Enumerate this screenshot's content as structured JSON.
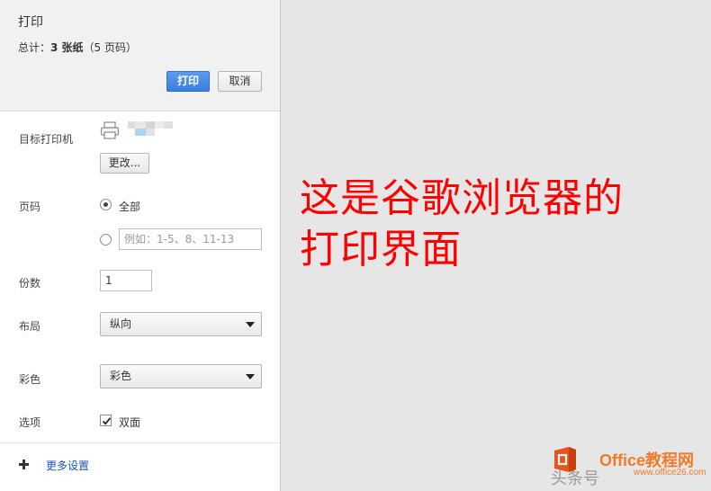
{
  "header": {
    "title": "打印",
    "summary_prefix": "总计：",
    "summary_count": "3 张纸",
    "summary_suffix": "（5 页码）",
    "print_label": "打印",
    "cancel_label": "取消"
  },
  "destination": {
    "label": "目标打印机",
    "change_label": "更改..."
  },
  "pages": {
    "label": "页码",
    "all_label": "全部",
    "all_selected": true,
    "custom_placeholder": "例如：1-5、8、11-13"
  },
  "copies": {
    "label": "份数",
    "value": "1"
  },
  "layout": {
    "label": "布局",
    "selected": "纵向"
  },
  "color": {
    "label": "彩色",
    "selected": "彩色"
  },
  "options": {
    "label": "选项",
    "duplex_label": "双面",
    "duplex_checked": true
  },
  "footer": {
    "more_settings_label": "更多设置"
  },
  "annotation": {
    "line1": "这是谷歌浏览器的",
    "line2": "打印界面"
  },
  "watermark": {
    "brand": "Office教程网",
    "url": "www.office26.com",
    "toutiao": "头条号"
  },
  "colors": {
    "primary_button": "#3a7de0",
    "link": "#1a55b8",
    "annotation": "#ff0000",
    "preview_bg": "#e6e6e6"
  }
}
